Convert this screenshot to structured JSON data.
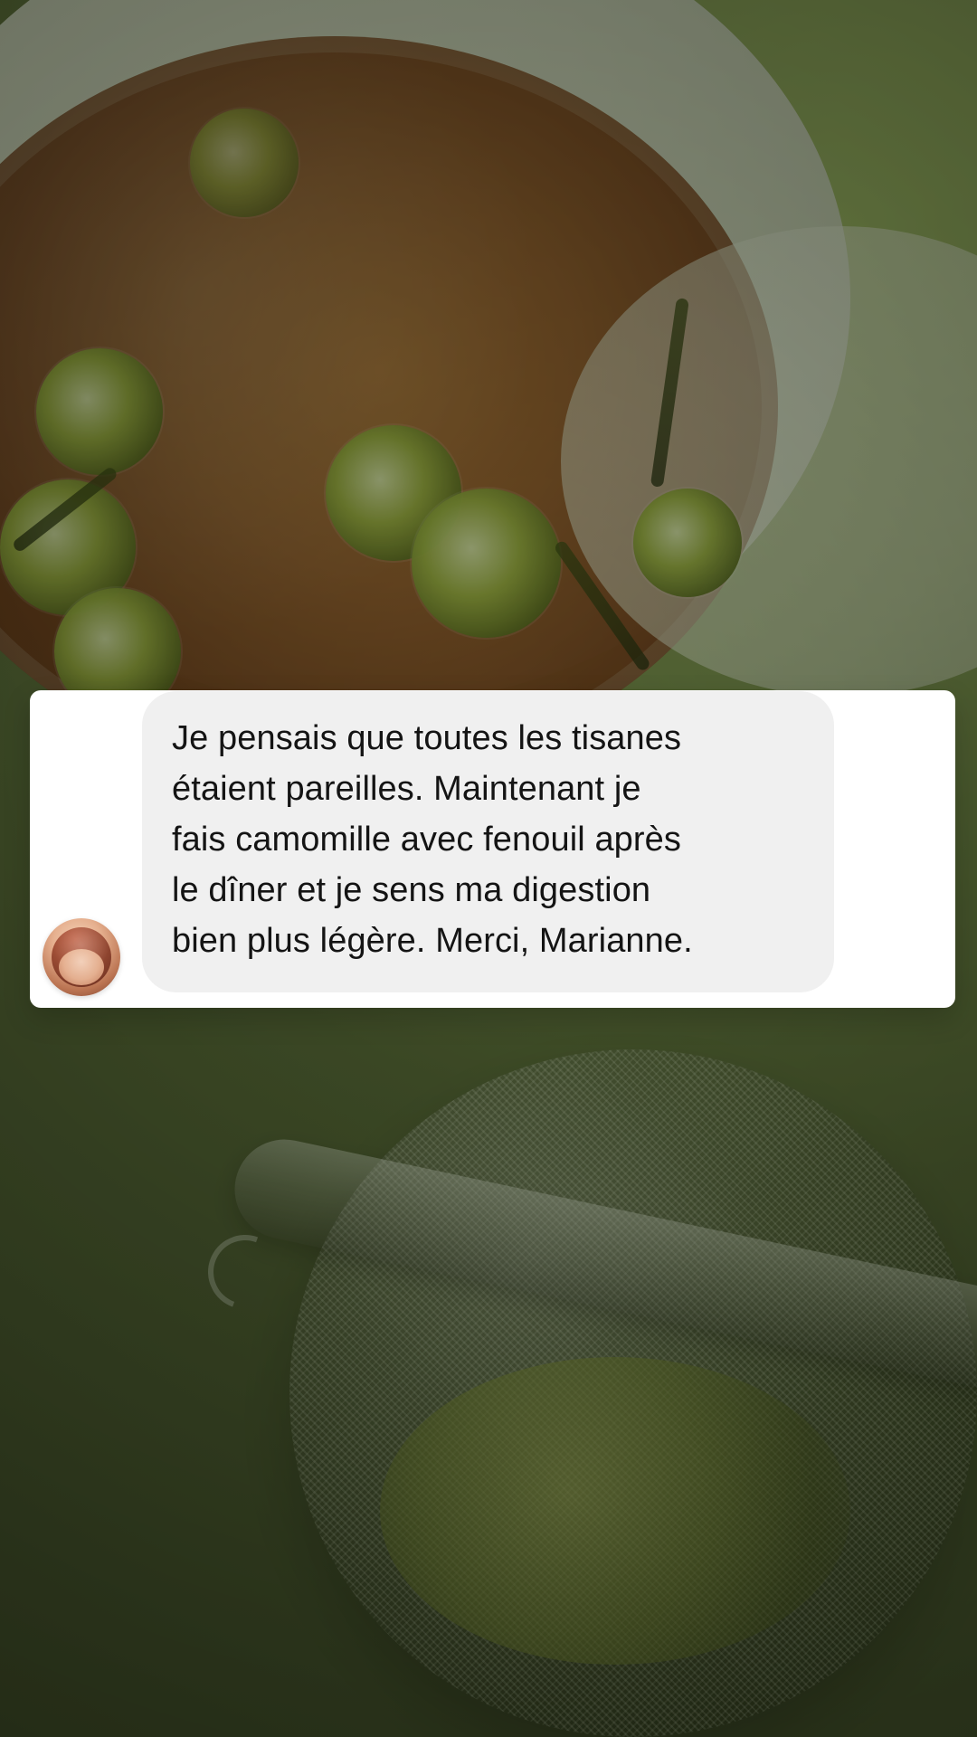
{
  "comment": {
    "text": "Je pensais que toutes les tisanes\nétaient pareilles. Maintenant je\nfais camomille avec fenouil après\nle dîner et je sens ma digestion\nbien plus légère. Merci, Marianne."
  }
}
